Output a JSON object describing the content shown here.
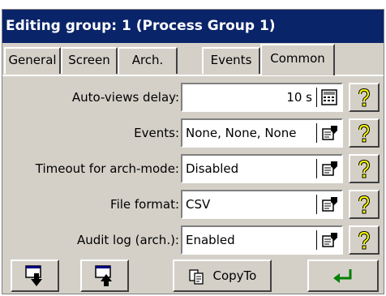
{
  "window": {
    "title": "Editing group: 1 (Process Group 1)"
  },
  "tabs": [
    {
      "label": "General"
    },
    {
      "label": "Screen"
    },
    {
      "label": "Arch."
    },
    {
      "label": "Events"
    },
    {
      "label": "Common",
      "active": true
    }
  ],
  "rows": [
    {
      "label": "Auto-views delay:",
      "value": "10 s",
      "icon": "calculator-icon"
    },
    {
      "label": "Events:",
      "value": "None, None, None",
      "icon": "list-edit-icon"
    },
    {
      "label": "Timeout for arch-mode:",
      "value": "Disabled",
      "icon": "list-edit-icon"
    },
    {
      "label": "File format:",
      "value": "CSV",
      "icon": "list-edit-icon"
    },
    {
      "label": "Audit log (arch.):",
      "value": "Enabled",
      "icon": "list-edit-icon"
    }
  ],
  "help_icon": "help-question-icon",
  "toolbar": {
    "save_icon": "download-icon",
    "load_icon": "upload-icon",
    "copy_label": "CopyTo",
    "copy_icon": "copy-icon",
    "enter_icon": "enter-arrow-icon"
  },
  "colors": {
    "titlebar": "#0a246a",
    "face": "#d4d0c8",
    "enter_arrow": "#008000",
    "help": "#ffff00"
  }
}
